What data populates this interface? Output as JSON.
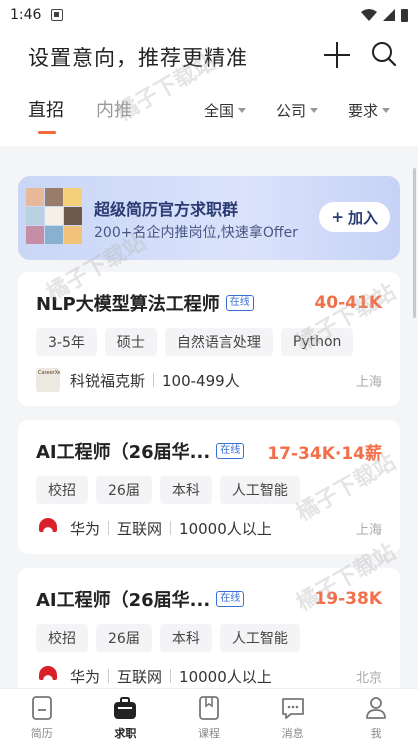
{
  "status_bar": {
    "time": "1:46"
  },
  "header": {
    "title": "设置意向，推荐更精准",
    "tabs": [
      {
        "label": "直招",
        "active": true
      },
      {
        "label": "内推",
        "active": false
      }
    ],
    "filters": [
      {
        "label": "全国"
      },
      {
        "label": "公司"
      },
      {
        "label": "要求"
      }
    ]
  },
  "banner": {
    "title": "超级简历官方求职群",
    "subtitle": "200+名企内推岗位,快速拿Offer",
    "button_label": "加入"
  },
  "jobs": [
    {
      "title": "NLP大模型算法工程师",
      "badge": "在线",
      "salary": "40-41K",
      "tags": [
        "3-5年",
        "硕士",
        "自然语言处理",
        "Python"
      ],
      "company": "科锐福克斯",
      "company_meta": "100-499人",
      "city": "上海"
    },
    {
      "title": "AI工程师（26届华...",
      "badge": "在线",
      "salary": "17-34K·14薪",
      "tags": [
        "校招",
        "26届",
        "本科",
        "人工智能"
      ],
      "company": "华为",
      "industry": "互联网",
      "company_meta": "10000人以上",
      "city": "上海"
    },
    {
      "title": "AI工程师（26届华...",
      "badge": "在线",
      "salary": "19-38K",
      "tags": [
        "校招",
        "26届",
        "本科",
        "人工智能"
      ],
      "company": "华为",
      "industry": "互联网",
      "company_meta": "10000人以上",
      "city": "北京"
    }
  ],
  "watermark": "橘子下载站",
  "bottom_nav": [
    {
      "label": "简历",
      "icon": "resume-icon",
      "active": false
    },
    {
      "label": "求职",
      "icon": "briefcase-icon",
      "active": true
    },
    {
      "label": "课程",
      "icon": "course-icon",
      "active": false
    },
    {
      "label": "消息",
      "icon": "message-icon",
      "active": false
    },
    {
      "label": "我",
      "icon": "profile-icon",
      "active": false
    }
  ]
}
